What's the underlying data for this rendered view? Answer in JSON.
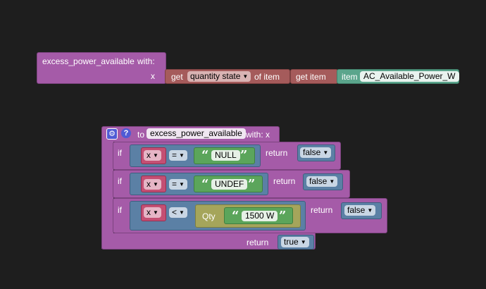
{
  "function_block": {
    "name": "excess_power_available",
    "with_label": "with:",
    "param": "x",
    "get_label": "get",
    "quantity_dropdown": "quantity state",
    "of_item_label": "of item",
    "get_item_label": "get item",
    "item_label": "item",
    "item_value": "AC_Available_Power_W"
  },
  "define_block": {
    "gear_icon": "gear-icon",
    "help_icon": "question-icon",
    "to_label": "to",
    "name": "excess_power_available",
    "with_label": "with: x",
    "rows": [
      {
        "if_label": "if",
        "var": "x",
        "op": "=",
        "quote_value": "NULL",
        "return_label": "return",
        "return_value": "false"
      },
      {
        "if_label": "if",
        "var": "x",
        "op": "=",
        "quote_value": "UNDEF",
        "return_label": "return",
        "return_value": "false"
      },
      {
        "if_label": "if",
        "var": "x",
        "op": "<",
        "qty_label": "Qty",
        "quote_value": "1500 W",
        "return_label": "return",
        "return_value": "false"
      }
    ],
    "final_return_label": "return",
    "final_return_value": "true"
  },
  "colors": {
    "background": "#1e1e1e",
    "procedure": "#a55ba8",
    "variable": "#a55b5b",
    "item": "#5ba58c",
    "logic": "#5b80a5"
  }
}
